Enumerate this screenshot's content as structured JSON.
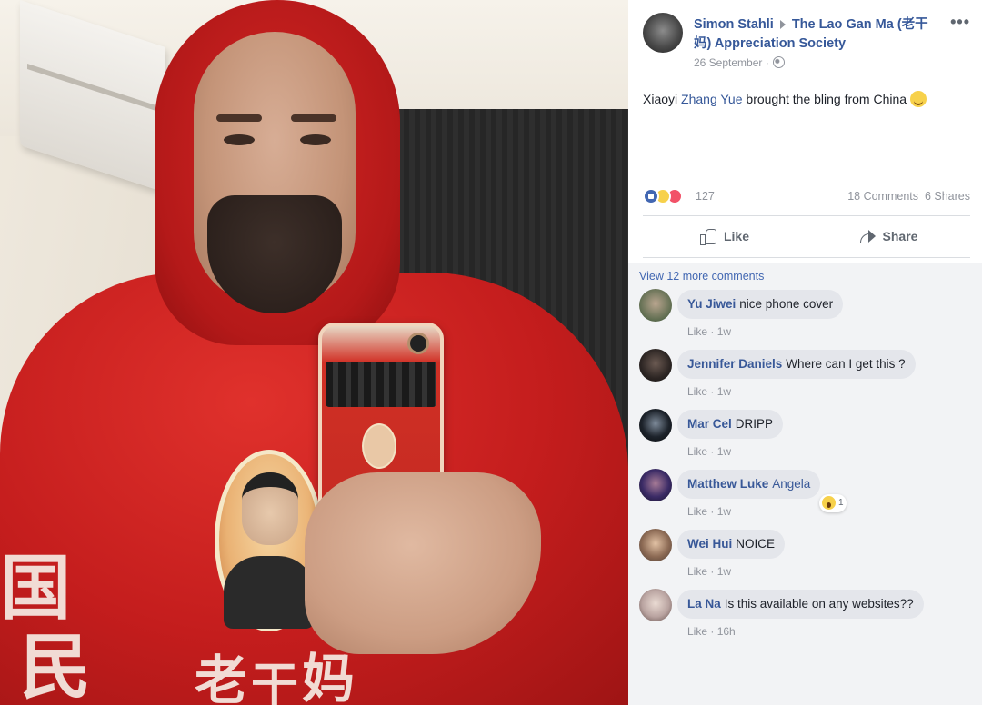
{
  "post": {
    "author": "Simon Stahli",
    "group": "The Lao Gan Ma (老干妈) Appreciation Society",
    "date": "26 September",
    "more_label": "•••",
    "text_before": "Xiaoyi ",
    "mention": "Zhang Yue",
    "text_after": " brought the bling from China",
    "reaction_count": "127",
    "comments_count": "18 Comments",
    "shares_count": "6 Shares",
    "like_label": "Like",
    "share_label": "Share"
  },
  "comments_section": {
    "view_more": "View 12 more comments",
    "like_label": "Like",
    "separator": " · ",
    "items": [
      {
        "name": "Yu Jiwei",
        "text": "nice phone cover",
        "time": "1w"
      },
      {
        "name": "Jennifer Daniels",
        "text": "Where can I get this ?",
        "time": "1w"
      },
      {
        "name": "Mar Cel",
        "text": "DRIPP",
        "time": "1w"
      },
      {
        "name": "Matthew Luke",
        "text": "Angela",
        "time": "1w",
        "reaction_count": "1"
      },
      {
        "name": "Wei Hui",
        "text": "NOICE",
        "time": "1w"
      },
      {
        "name": "La Na",
        "text": "Is this available on any websites??",
        "time": "16h"
      }
    ]
  },
  "photo": {
    "description_icon": "photo-image",
    "glyphs": [
      "国",
      "民",
      "老",
      "干",
      "妈"
    ]
  },
  "colors": {
    "link_blue": "#365899",
    "hoodie_red": "#c41d1d",
    "comment_bg": "#f2f3f5",
    "bubble_bg": "#e4e6eb"
  }
}
